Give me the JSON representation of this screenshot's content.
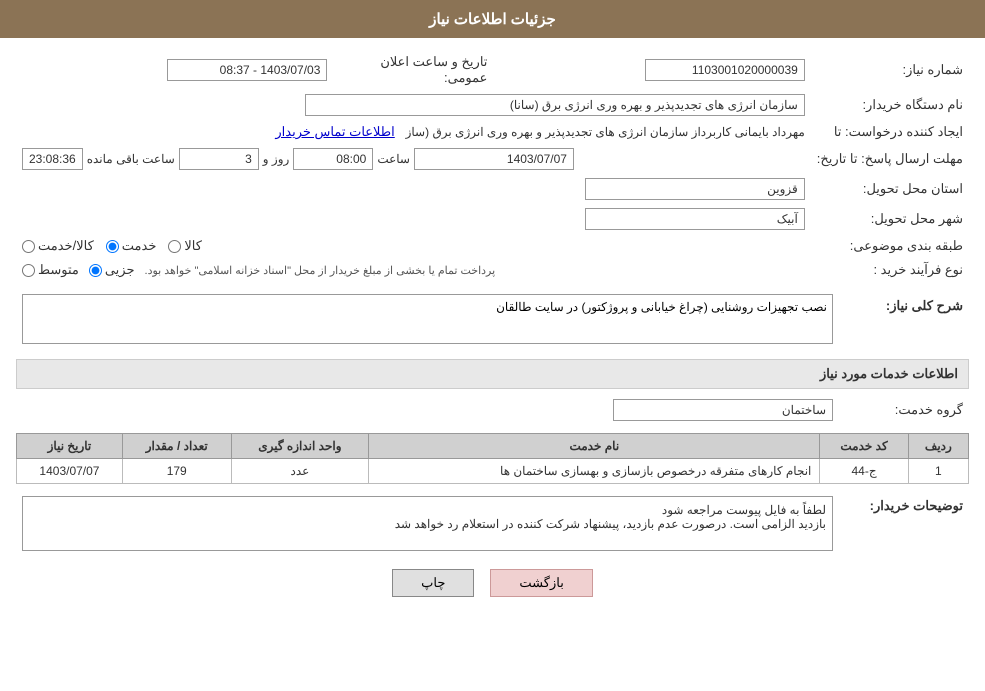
{
  "header": {
    "title": "جزئیات اطلاعات نیاز"
  },
  "fields": {
    "shomareNiaz_label": "شماره نیاز:",
    "shomareNiaz_value": "1103001020000039",
    "namDastgah_label": "نام دستگاه خریدار:",
    "namDastgah_value": "سازمان انرژی های تجدیدپذیر و بهره وری انرژی برق (سانا)",
    "ijadKonande_label": "ایجاد کننده درخواست: تا",
    "ijadKonande_value": "مهرداد بایمانی کاربرداز سازمان انرژی های تجدیدپذیر و بهره وری انرژی برق (ساز",
    "ijadKonande_link": "اطلاعات تماس خریدار",
    "mohlat_label": "مهلت ارسال پاسخ: تا تاریخ:",
    "mohlat_date": "1403/07/07",
    "mohlat_saat_label": "ساعت",
    "mohlat_saat": "08:00",
    "mohlat_rooz_label": "روز و",
    "mohlat_rooz": "3",
    "mohlat_countdown": "23:08:36",
    "mohlat_countdown_label": "ساعت باقی مانده",
    "ostan_label": "استان محل تحویل:",
    "ostan_value": "قزوین",
    "shahr_label": "شهر محل تحویل:",
    "shahr_value": "آبیک",
    "tabaqe_label": "طبقه بندی موضوعی:",
    "tabaqe_kala": "کالا",
    "tabaqe_khadamat": "خدمت",
    "tabaqe_kala_khadamat": "کالا/خدمت",
    "noeFarayand_label": "نوع فرآیند خرید :",
    "noeFarayand_jozi": "جزیی",
    "noeFarayand_motovaset": "متوسط",
    "noeFarayand_desc": "پرداخت تمام یا بخشی از مبلغ خریدار از محل \"اسناد خزانه اسلامی\" خواهد بود.",
    "sharhKoli_label": "شرح کلی نیاز:",
    "sharhKoli_value": "نصب تجهیزات روشنایی (چراغ خیابانی و پروژکتور) در سایت طالقان",
    "ettelaatKhadamat_header": "اطلاعات خدمات مورد نیاز",
    "garohKhadamat_label": "گروه خدمت:",
    "garohKhadamat_value": "ساختمان",
    "table": {
      "headers": [
        "ردیف",
        "کد خدمت",
        "نام خدمت",
        "واحد اندازه گیری",
        "تعداد / مقدار",
        "تاریخ نیاز"
      ],
      "rows": [
        {
          "radif": "1",
          "kodKhadamat": "ج-44",
          "namKhadamat": "انجام کارهای متفرقه درخصوص بازسازی و بهسازی ساختمان ها",
          "vahed": "عدد",
          "tedad": "179",
          "tarikh": "1403/07/07"
        }
      ]
    },
    "tavzihat_label": "توضیحات خریدار:",
    "tavzihat_line1": "لطفاً به فایل پیوست مراجعه شود",
    "tavzihat_line2": "بازدید الزامی است. درصورت عدم بازدید، پیشنهاد شرکت کننده در استعلام رد خواهد شد",
    "btn_chap": "چاپ",
    "btn_bazgasht": "بازگشت",
    "tarikh_label": "تاریخ و ساعت اعلان عمومی:",
    "tarikh_value": "1403/07/03 - 08:37"
  }
}
